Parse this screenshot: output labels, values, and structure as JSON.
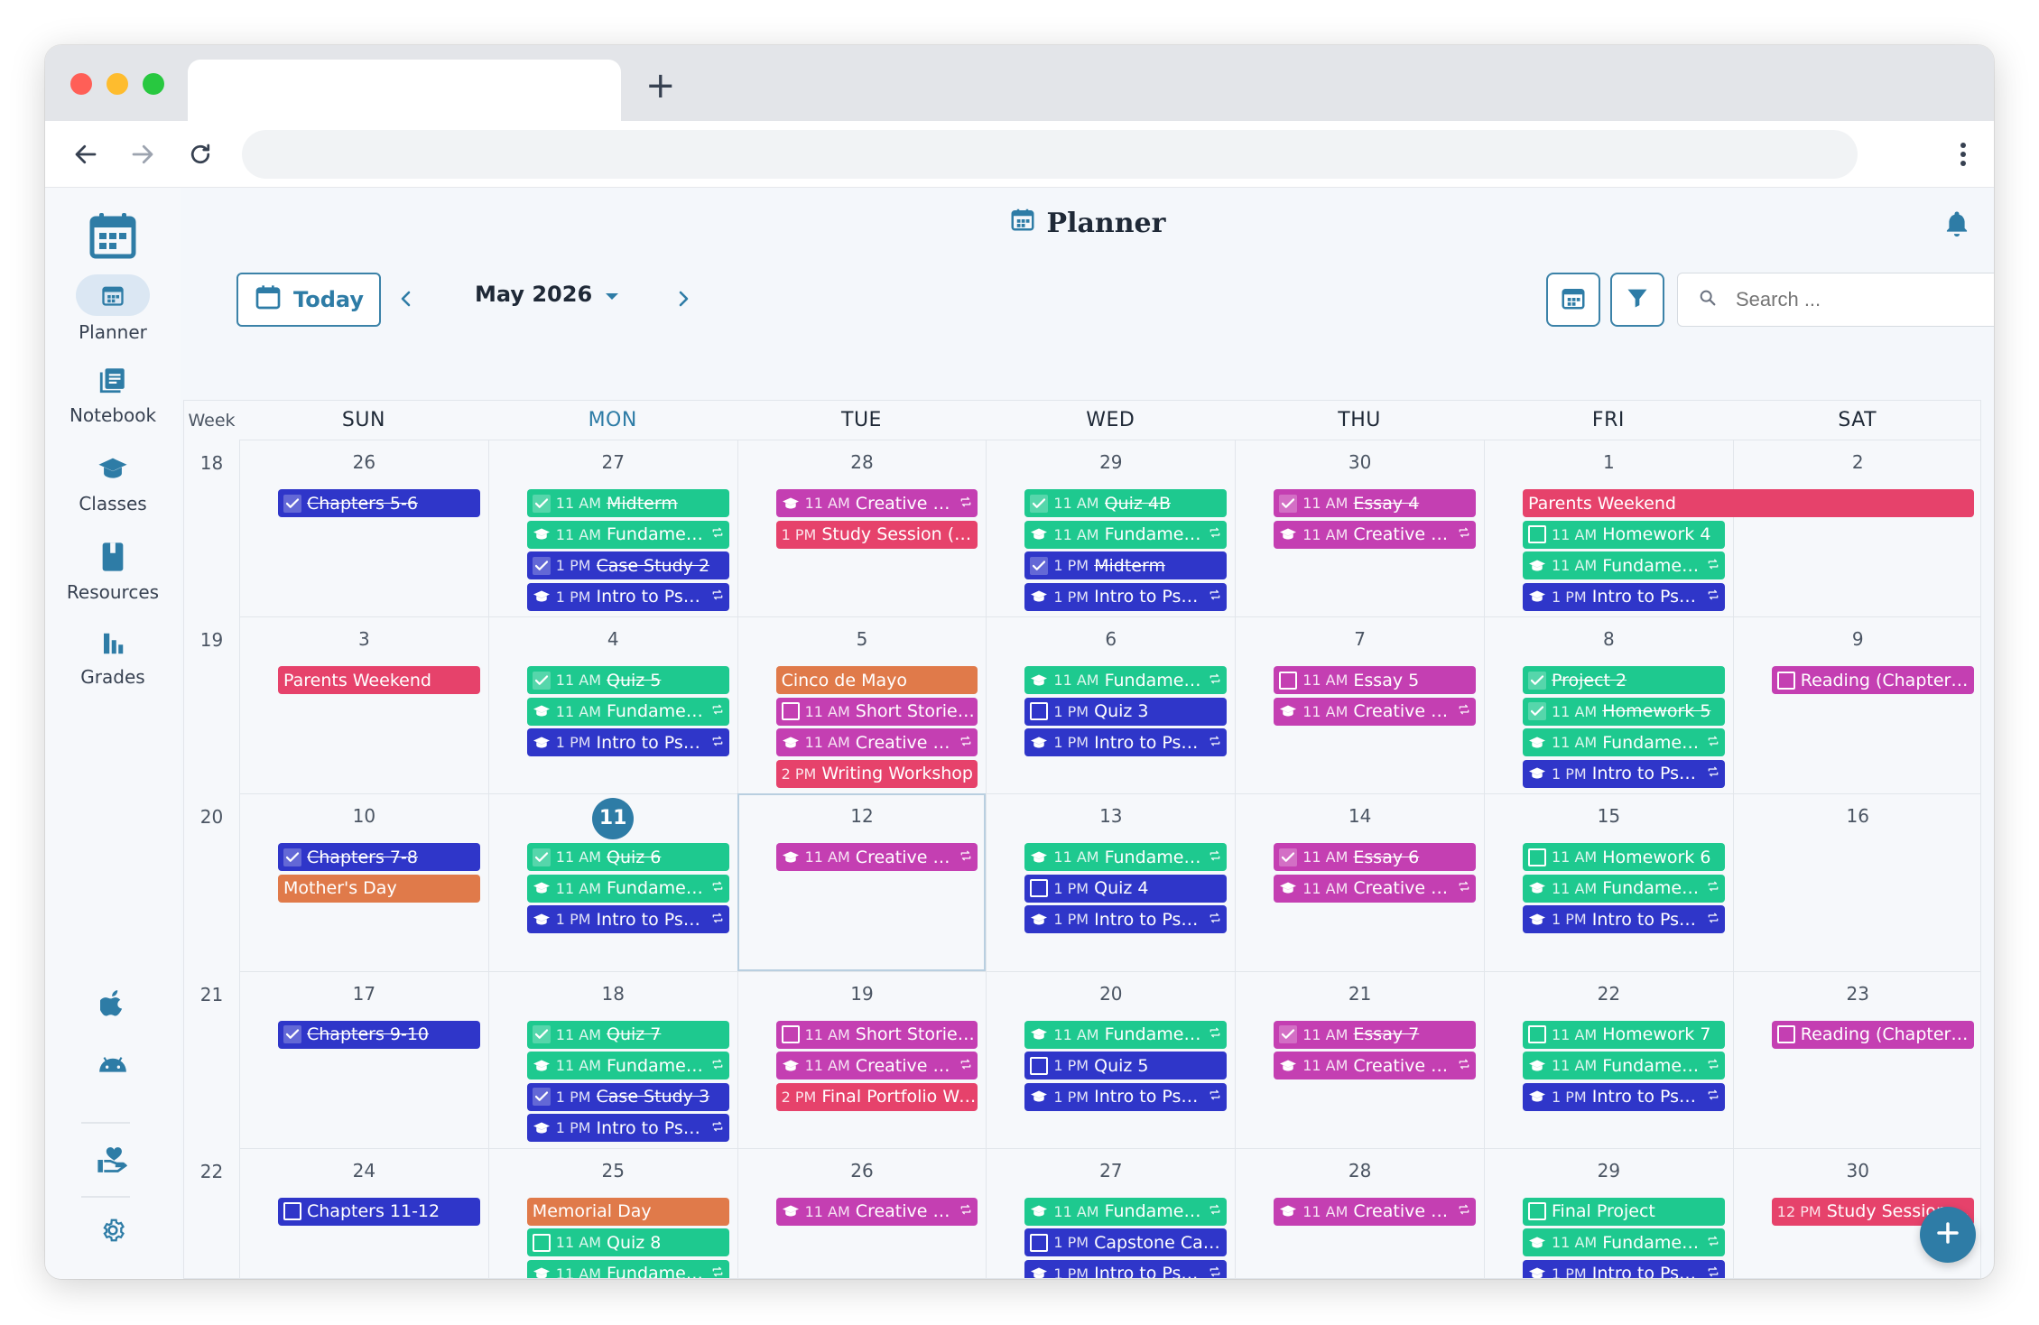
{
  "browser": {
    "new_tab_label": "+"
  },
  "sidebar": {
    "items": [
      {
        "name": "planner",
        "label": "Planner",
        "icon": "calendar-icon"
      },
      {
        "name": "notebook",
        "label": "Notebook",
        "icon": "notebook-icon"
      },
      {
        "name": "classes",
        "label": "Classes",
        "icon": "graduation-cap-icon"
      },
      {
        "name": "resources",
        "label": "Resources",
        "icon": "book-icon"
      },
      {
        "name": "grades",
        "label": "Grades",
        "icon": "bar-chart-icon"
      }
    ],
    "bottom_icons": [
      "apple-icon",
      "android-icon",
      "donate-heart-icon",
      "gear-icon"
    ]
  },
  "header": {
    "title": "Planner"
  },
  "controls": {
    "today_label": "Today",
    "month_label": "May 2026",
    "search_placeholder": "Search ..."
  },
  "calendar": {
    "week_label": "Week",
    "days": [
      "SUN",
      "MON",
      "TUE",
      "WED",
      "THU",
      "FRI",
      "SAT"
    ],
    "active_day_index": 1,
    "weeks": [
      {
        "number": "18",
        "dates": [
          "26",
          "27",
          "28",
          "29",
          "30",
          "1",
          "2"
        ]
      },
      {
        "number": "19",
        "dates": [
          "3",
          "4",
          "5",
          "6",
          "7",
          "8",
          "9"
        ]
      },
      {
        "number": "20",
        "dates": [
          "10",
          "11",
          "12",
          "13",
          "14",
          "15",
          "16"
        ]
      },
      {
        "number": "21",
        "dates": [
          "17",
          "18",
          "19",
          "20",
          "21",
          "22",
          "23"
        ]
      },
      {
        "number": "22",
        "dates": [
          "24",
          "25",
          "26",
          "27",
          "28",
          "29",
          "30"
        ]
      }
    ],
    "today": {
      "week": 2,
      "day": 1
    },
    "selected": {
      "week": 2,
      "day": 2
    }
  },
  "colors": {
    "blue": "#2f36c9",
    "green": "#1ec98f",
    "magenta": "#c43fb2",
    "pink": "#e6426b",
    "orange": "#e07a4a",
    "accent": "#2e7ca6"
  },
  "events": [
    {
      "w": 0,
      "d": 0,
      "slot": 0,
      "color": "blue",
      "kind": "check",
      "done": true,
      "title": "Chapters 5-6"
    },
    {
      "w": 0,
      "d": 1,
      "slot": 0,
      "color": "green",
      "kind": "check",
      "done": true,
      "time": "11 AM",
      "title": "Midterm"
    },
    {
      "w": 0,
      "d": 1,
      "slot": 1,
      "color": "green",
      "kind": "class",
      "time": "11 AM",
      "title": "Fundamentals ...",
      "repeat": true
    },
    {
      "w": 0,
      "d": 1,
      "slot": 2,
      "color": "blue",
      "kind": "check",
      "done": true,
      "time": "1 PM",
      "title": "Case Study 2"
    },
    {
      "w": 0,
      "d": 1,
      "slot": 3,
      "color": "blue",
      "kind": "class",
      "time": "1 PM",
      "title": "Intro to Psychol...",
      "repeat": true
    },
    {
      "w": 0,
      "d": 2,
      "slot": 0,
      "color": "magenta",
      "kind": "class",
      "time": "11 AM",
      "title": "Creative Writin...",
      "repeat": true
    },
    {
      "w": 0,
      "d": 2,
      "slot": 1,
      "color": "pink",
      "kind": "plain",
      "time": "1 PM",
      "title": "Study Session (Midte..."
    },
    {
      "w": 0,
      "d": 3,
      "slot": 0,
      "color": "green",
      "kind": "check",
      "done": true,
      "time": "11 AM",
      "title": "Quiz 4B"
    },
    {
      "w": 0,
      "d": 3,
      "slot": 1,
      "color": "green",
      "kind": "class",
      "time": "11 AM",
      "title": "Fundamentals ...",
      "repeat": true
    },
    {
      "w": 0,
      "d": 3,
      "slot": 2,
      "color": "blue",
      "kind": "check",
      "done": true,
      "time": "1 PM",
      "title": "Midterm"
    },
    {
      "w": 0,
      "d": 3,
      "slot": 3,
      "color": "blue",
      "kind": "class",
      "time": "1 PM",
      "title": "Intro to Psychol...",
      "repeat": true
    },
    {
      "w": 0,
      "d": 4,
      "slot": 0,
      "color": "magenta",
      "kind": "check",
      "done": true,
      "time": "11 AM",
      "title": "Essay 4"
    },
    {
      "w": 0,
      "d": 4,
      "slot": 1,
      "color": "magenta",
      "kind": "class",
      "time": "11 AM",
      "title": "Creative Writin...",
      "repeat": true
    },
    {
      "w": 0,
      "d": 5,
      "slot": 0,
      "color": "pink",
      "kind": "plain",
      "span": 2,
      "title": "Parents Weekend"
    },
    {
      "w": 0,
      "d": 5,
      "slot": 1,
      "color": "green",
      "kind": "check",
      "done": false,
      "time": "11 AM",
      "title": "Homework 4"
    },
    {
      "w": 0,
      "d": 5,
      "slot": 2,
      "color": "green",
      "kind": "class",
      "time": "11 AM",
      "title": "Fundamentals ...",
      "repeat": true
    },
    {
      "w": 0,
      "d": 5,
      "slot": 3,
      "color": "blue",
      "kind": "class",
      "time": "1 PM",
      "title": "Intro to Psychol...",
      "repeat": true
    },
    {
      "w": 1,
      "d": 0,
      "slot": 0,
      "color": "pink",
      "kind": "plain",
      "title": "Parents Weekend"
    },
    {
      "w": 1,
      "d": 1,
      "slot": 0,
      "color": "green",
      "kind": "check",
      "done": true,
      "time": "11 AM",
      "title": "Quiz 5"
    },
    {
      "w": 1,
      "d": 1,
      "slot": 1,
      "color": "green",
      "kind": "class",
      "time": "11 AM",
      "title": "Fundamentals ...",
      "repeat": true
    },
    {
      "w": 1,
      "d": 1,
      "slot": 2,
      "color": "blue",
      "kind": "class",
      "time": "1 PM",
      "title": "Intro to Psychol...",
      "repeat": true
    },
    {
      "w": 1,
      "d": 2,
      "slot": 0,
      "color": "orange",
      "kind": "plain",
      "title": "Cinco de Mayo"
    },
    {
      "w": 1,
      "d": 2,
      "slot": 1,
      "color": "magenta",
      "kind": "check",
      "done": false,
      "time": "11 AM",
      "title": "Short Stories 3"
    },
    {
      "w": 1,
      "d": 2,
      "slot": 2,
      "color": "magenta",
      "kind": "class",
      "time": "11 AM",
      "title": "Creative Writin...",
      "repeat": true
    },
    {
      "w": 1,
      "d": 2,
      "slot": 3,
      "color": "pink",
      "kind": "plain",
      "time": "2 PM",
      "title": "Writing Workshop"
    },
    {
      "w": 1,
      "d": 3,
      "slot": 0,
      "color": "green",
      "kind": "class",
      "time": "11 AM",
      "title": "Fundamentals ...",
      "repeat": true
    },
    {
      "w": 1,
      "d": 3,
      "slot": 1,
      "color": "blue",
      "kind": "check",
      "done": false,
      "time": "1 PM",
      "title": "Quiz 3"
    },
    {
      "w": 1,
      "d": 3,
      "slot": 2,
      "color": "blue",
      "kind": "class",
      "time": "1 PM",
      "title": "Intro to Psychol...",
      "repeat": true
    },
    {
      "w": 1,
      "d": 4,
      "slot": 0,
      "color": "magenta",
      "kind": "check",
      "done": false,
      "time": "11 AM",
      "title": "Essay 5"
    },
    {
      "w": 1,
      "d": 4,
      "slot": 1,
      "color": "magenta",
      "kind": "class",
      "time": "11 AM",
      "title": "Creative Writin...",
      "repeat": true
    },
    {
      "w": 1,
      "d": 5,
      "slot": 0,
      "color": "green",
      "kind": "check",
      "done": true,
      "title": "Project 2"
    },
    {
      "w": 1,
      "d": 5,
      "slot": 1,
      "color": "green",
      "kind": "check",
      "done": true,
      "time": "11 AM",
      "title": "Homework 5"
    },
    {
      "w": 1,
      "d": 5,
      "slot": 2,
      "color": "green",
      "kind": "class",
      "time": "11 AM",
      "title": "Fundamentals ...",
      "repeat": true
    },
    {
      "w": 1,
      "d": 5,
      "slot": 3,
      "color": "blue",
      "kind": "class",
      "time": "1 PM",
      "title": "Intro to Psychol...",
      "repeat": true
    },
    {
      "w": 1,
      "d": 6,
      "slot": 0,
      "color": "magenta",
      "kind": "check",
      "done": false,
      "title": "Reading (Chapters 9-..."
    },
    {
      "w": 2,
      "d": 0,
      "slot": 0,
      "color": "blue",
      "kind": "check",
      "done": true,
      "title": "Chapters 7-8"
    },
    {
      "w": 2,
      "d": 0,
      "slot": 1,
      "color": "orange",
      "kind": "plain",
      "title": "Mother's Day"
    },
    {
      "w": 2,
      "d": 1,
      "slot": 0,
      "color": "green",
      "kind": "check",
      "done": true,
      "time": "11 AM",
      "title": "Quiz 6"
    },
    {
      "w": 2,
      "d": 1,
      "slot": 1,
      "color": "green",
      "kind": "class",
      "time": "11 AM",
      "title": "Fundamentals ...",
      "repeat": true
    },
    {
      "w": 2,
      "d": 1,
      "slot": 2,
      "color": "blue",
      "kind": "class",
      "time": "1 PM",
      "title": "Intro to Psychol...",
      "repeat": true
    },
    {
      "w": 2,
      "d": 2,
      "slot": 0,
      "color": "magenta",
      "kind": "class",
      "time": "11 AM",
      "title": "Creative Writin...",
      "repeat": true
    },
    {
      "w": 2,
      "d": 3,
      "slot": 0,
      "color": "green",
      "kind": "class",
      "time": "11 AM",
      "title": "Fundamentals ...",
      "repeat": true
    },
    {
      "w": 2,
      "d": 3,
      "slot": 1,
      "color": "blue",
      "kind": "check",
      "done": false,
      "time": "1 PM",
      "title": "Quiz 4"
    },
    {
      "w": 2,
      "d": 3,
      "slot": 2,
      "color": "blue",
      "kind": "class",
      "time": "1 PM",
      "title": "Intro to Psychol...",
      "repeat": true
    },
    {
      "w": 2,
      "d": 4,
      "slot": 0,
      "color": "magenta",
      "kind": "check",
      "done": true,
      "time": "11 AM",
      "title": "Essay 6"
    },
    {
      "w": 2,
      "d": 4,
      "slot": 1,
      "color": "magenta",
      "kind": "class",
      "time": "11 AM",
      "title": "Creative Writin...",
      "repeat": true
    },
    {
      "w": 2,
      "d": 5,
      "slot": 0,
      "color": "green",
      "kind": "check",
      "done": false,
      "time": "11 AM",
      "title": "Homework 6"
    },
    {
      "w": 2,
      "d": 5,
      "slot": 1,
      "color": "green",
      "kind": "class",
      "time": "11 AM",
      "title": "Fundamentals ...",
      "repeat": true
    },
    {
      "w": 2,
      "d": 5,
      "slot": 2,
      "color": "blue",
      "kind": "class",
      "time": "1 PM",
      "title": "Intro to Psychol...",
      "repeat": true
    },
    {
      "w": 3,
      "d": 0,
      "slot": 0,
      "color": "blue",
      "kind": "check",
      "done": true,
      "title": "Chapters 9-10"
    },
    {
      "w": 3,
      "d": 1,
      "slot": 0,
      "color": "green",
      "kind": "check",
      "done": true,
      "time": "11 AM",
      "title": "Quiz 7"
    },
    {
      "w": 3,
      "d": 1,
      "slot": 1,
      "color": "green",
      "kind": "class",
      "time": "11 AM",
      "title": "Fundamentals ...",
      "repeat": true
    },
    {
      "w": 3,
      "d": 1,
      "slot": 2,
      "color": "blue",
      "kind": "check",
      "done": true,
      "time": "1 PM",
      "title": "Case Study 3"
    },
    {
      "w": 3,
      "d": 1,
      "slot": 3,
      "color": "blue",
      "kind": "class",
      "time": "1 PM",
      "title": "Intro to Psychol...",
      "repeat": true
    },
    {
      "w": 3,
      "d": 2,
      "slot": 0,
      "color": "magenta",
      "kind": "check",
      "done": false,
      "time": "11 AM",
      "title": "Short Stories 4"
    },
    {
      "w": 3,
      "d": 2,
      "slot": 1,
      "color": "magenta",
      "kind": "class",
      "time": "11 AM",
      "title": "Creative Writin...",
      "repeat": true
    },
    {
      "w": 3,
      "d": 2,
      "slot": 2,
      "color": "pink",
      "kind": "plain",
      "time": "2 PM",
      "title": "Final Portfolio Writin..."
    },
    {
      "w": 3,
      "d": 3,
      "slot": 0,
      "color": "green",
      "kind": "class",
      "time": "11 AM",
      "title": "Fundamentals ...",
      "repeat": true
    },
    {
      "w": 3,
      "d": 3,
      "slot": 1,
      "color": "blue",
      "kind": "check",
      "done": false,
      "time": "1 PM",
      "title": "Quiz 5"
    },
    {
      "w": 3,
      "d": 3,
      "slot": 2,
      "color": "blue",
      "kind": "class",
      "time": "1 PM",
      "title": "Intro to Psychol...",
      "repeat": true
    },
    {
      "w": 3,
      "d": 4,
      "slot": 0,
      "color": "magenta",
      "kind": "check",
      "done": true,
      "time": "11 AM",
      "title": "Essay 7"
    },
    {
      "w": 3,
      "d": 4,
      "slot": 1,
      "color": "magenta",
      "kind": "class",
      "time": "11 AM",
      "title": "Creative Writin...",
      "repeat": true
    },
    {
      "w": 3,
      "d": 5,
      "slot": 0,
      "color": "green",
      "kind": "check",
      "done": false,
      "time": "11 AM",
      "title": "Homework 7"
    },
    {
      "w": 3,
      "d": 5,
      "slot": 1,
      "color": "green",
      "kind": "class",
      "time": "11 AM",
      "title": "Fundamentals ...",
      "repeat": true
    },
    {
      "w": 3,
      "d": 5,
      "slot": 2,
      "color": "blue",
      "kind": "class",
      "time": "1 PM",
      "title": "Intro to Psychol...",
      "repeat": true
    },
    {
      "w": 3,
      "d": 6,
      "slot": 0,
      "color": "magenta",
      "kind": "check",
      "done": false,
      "title": "Reading (Chapters 13..."
    },
    {
      "w": 4,
      "d": 0,
      "slot": 0,
      "color": "blue",
      "kind": "check",
      "done": false,
      "title": "Chapters 11-12"
    },
    {
      "w": 4,
      "d": 1,
      "slot": 0,
      "color": "orange",
      "kind": "plain",
      "title": "Memorial Day"
    },
    {
      "w": 4,
      "d": 1,
      "slot": 1,
      "color": "green",
      "kind": "check",
      "done": false,
      "time": "11 AM",
      "title": "Quiz 8"
    },
    {
      "w": 4,
      "d": 1,
      "slot": 2,
      "color": "green",
      "kind": "class",
      "time": "11 AM",
      "title": "Fundamentals ...",
      "repeat": true
    },
    {
      "w": 4,
      "d": 1,
      "slot": 3,
      "color": "blue",
      "kind": "class",
      "time": "1 PM",
      "title": "Intro to Psychol...",
      "repeat": true
    },
    {
      "w": 4,
      "d": 2,
      "slot": 0,
      "color": "magenta",
      "kind": "class",
      "time": "11 AM",
      "title": "Creative Writin...",
      "repeat": true
    },
    {
      "w": 4,
      "d": 3,
      "slot": 0,
      "color": "green",
      "kind": "class",
      "time": "11 AM",
      "title": "Fundamentals ...",
      "repeat": true
    },
    {
      "w": 4,
      "d": 3,
      "slot": 1,
      "color": "blue",
      "kind": "check",
      "done": false,
      "time": "1 PM",
      "title": "Capstone Case S..."
    },
    {
      "w": 4,
      "d": 3,
      "slot": 2,
      "color": "blue",
      "kind": "class",
      "time": "1 PM",
      "title": "Intro to Psychol...",
      "repeat": true
    },
    {
      "w": 4,
      "d": 4,
      "slot": 0,
      "color": "magenta",
      "kind": "class",
      "time": "11 AM",
      "title": "Creative Writin...",
      "repeat": true
    },
    {
      "w": 4,
      "d": 5,
      "slot": 0,
      "color": "green",
      "kind": "check",
      "done": false,
      "title": "Final Project"
    },
    {
      "w": 4,
      "d": 5,
      "slot": 1,
      "color": "green",
      "kind": "class",
      "time": "11 AM",
      "title": "Fundamentals ...",
      "repeat": true
    },
    {
      "w": 4,
      "d": 5,
      "slot": 2,
      "color": "blue",
      "kind": "class",
      "time": "1 PM",
      "title": "Intro to Psychol...",
      "repeat": true
    },
    {
      "w": 4,
      "d": 6,
      "slot": 0,
      "color": "pink",
      "kind": "plain",
      "time": "12 PM",
      "title": "Study Session (Fina..."
    }
  ]
}
